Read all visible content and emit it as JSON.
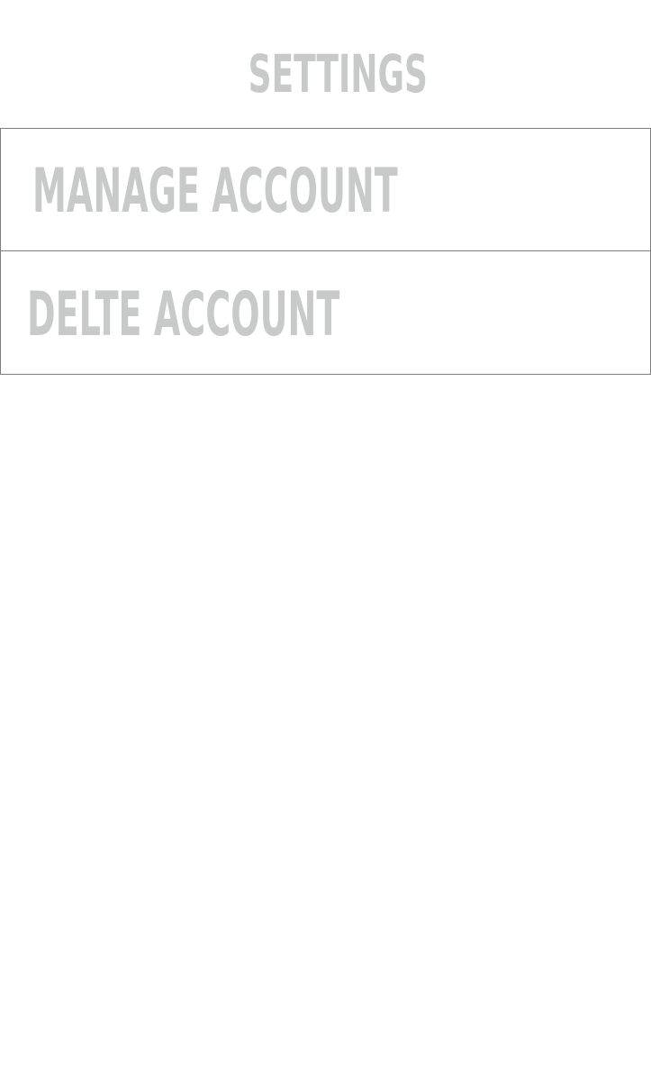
{
  "header": {
    "title": "SETTINGS"
  },
  "menu": {
    "items": [
      {
        "label": "MANAGE ACCOUNT"
      },
      {
        "label": "DELTE ACCOUNT"
      }
    ]
  },
  "colors": {
    "text": "#c8cac9",
    "border": "#7f7f7f",
    "background": "#ffffff"
  }
}
